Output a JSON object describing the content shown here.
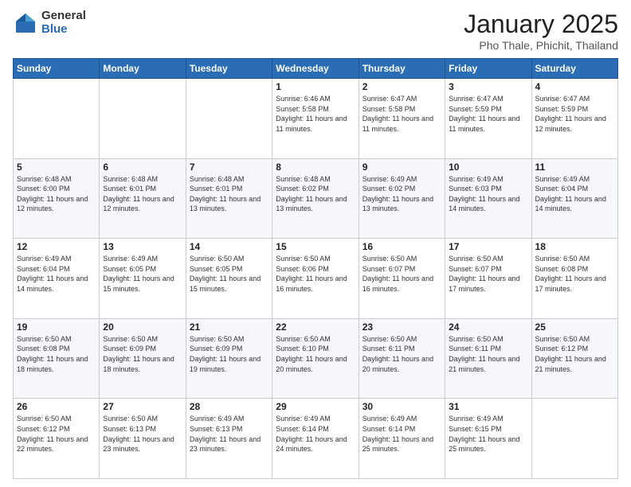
{
  "logo": {
    "general": "General",
    "blue": "Blue"
  },
  "title": {
    "month_year": "January 2025",
    "location": "Pho Thale, Phichit, Thailand"
  },
  "weekdays": [
    "Sunday",
    "Monday",
    "Tuesday",
    "Wednesday",
    "Thursday",
    "Friday",
    "Saturday"
  ],
  "weeks": [
    [
      {
        "day": "",
        "info": ""
      },
      {
        "day": "",
        "info": ""
      },
      {
        "day": "",
        "info": ""
      },
      {
        "day": "1",
        "info": "Sunrise: 6:46 AM\nSunset: 5:58 PM\nDaylight: 11 hours and 11 minutes."
      },
      {
        "day": "2",
        "info": "Sunrise: 6:47 AM\nSunset: 5:58 PM\nDaylight: 11 hours and 11 minutes."
      },
      {
        "day": "3",
        "info": "Sunrise: 6:47 AM\nSunset: 5:59 PM\nDaylight: 11 hours and 11 minutes."
      },
      {
        "day": "4",
        "info": "Sunrise: 6:47 AM\nSunset: 5:59 PM\nDaylight: 11 hours and 12 minutes."
      }
    ],
    [
      {
        "day": "5",
        "info": "Sunrise: 6:48 AM\nSunset: 6:00 PM\nDaylight: 11 hours and 12 minutes."
      },
      {
        "day": "6",
        "info": "Sunrise: 6:48 AM\nSunset: 6:01 PM\nDaylight: 11 hours and 12 minutes."
      },
      {
        "day": "7",
        "info": "Sunrise: 6:48 AM\nSunset: 6:01 PM\nDaylight: 11 hours and 13 minutes."
      },
      {
        "day": "8",
        "info": "Sunrise: 6:48 AM\nSunset: 6:02 PM\nDaylight: 11 hours and 13 minutes."
      },
      {
        "day": "9",
        "info": "Sunrise: 6:49 AM\nSunset: 6:02 PM\nDaylight: 11 hours and 13 minutes."
      },
      {
        "day": "10",
        "info": "Sunrise: 6:49 AM\nSunset: 6:03 PM\nDaylight: 11 hours and 14 minutes."
      },
      {
        "day": "11",
        "info": "Sunrise: 6:49 AM\nSunset: 6:04 PM\nDaylight: 11 hours and 14 minutes."
      }
    ],
    [
      {
        "day": "12",
        "info": "Sunrise: 6:49 AM\nSunset: 6:04 PM\nDaylight: 11 hours and 14 minutes."
      },
      {
        "day": "13",
        "info": "Sunrise: 6:49 AM\nSunset: 6:05 PM\nDaylight: 11 hours and 15 minutes."
      },
      {
        "day": "14",
        "info": "Sunrise: 6:50 AM\nSunset: 6:05 PM\nDaylight: 11 hours and 15 minutes."
      },
      {
        "day": "15",
        "info": "Sunrise: 6:50 AM\nSunset: 6:06 PM\nDaylight: 11 hours and 16 minutes."
      },
      {
        "day": "16",
        "info": "Sunrise: 6:50 AM\nSunset: 6:07 PM\nDaylight: 11 hours and 16 minutes."
      },
      {
        "day": "17",
        "info": "Sunrise: 6:50 AM\nSunset: 6:07 PM\nDaylight: 11 hours and 17 minutes."
      },
      {
        "day": "18",
        "info": "Sunrise: 6:50 AM\nSunset: 6:08 PM\nDaylight: 11 hours and 17 minutes."
      }
    ],
    [
      {
        "day": "19",
        "info": "Sunrise: 6:50 AM\nSunset: 6:08 PM\nDaylight: 11 hours and 18 minutes."
      },
      {
        "day": "20",
        "info": "Sunrise: 6:50 AM\nSunset: 6:09 PM\nDaylight: 11 hours and 18 minutes."
      },
      {
        "day": "21",
        "info": "Sunrise: 6:50 AM\nSunset: 6:09 PM\nDaylight: 11 hours and 19 minutes."
      },
      {
        "day": "22",
        "info": "Sunrise: 6:50 AM\nSunset: 6:10 PM\nDaylight: 11 hours and 20 minutes."
      },
      {
        "day": "23",
        "info": "Sunrise: 6:50 AM\nSunset: 6:11 PM\nDaylight: 11 hours and 20 minutes."
      },
      {
        "day": "24",
        "info": "Sunrise: 6:50 AM\nSunset: 6:11 PM\nDaylight: 11 hours and 21 minutes."
      },
      {
        "day": "25",
        "info": "Sunrise: 6:50 AM\nSunset: 6:12 PM\nDaylight: 11 hours and 21 minutes."
      }
    ],
    [
      {
        "day": "26",
        "info": "Sunrise: 6:50 AM\nSunset: 6:12 PM\nDaylight: 11 hours and 22 minutes."
      },
      {
        "day": "27",
        "info": "Sunrise: 6:50 AM\nSunset: 6:13 PM\nDaylight: 11 hours and 23 minutes."
      },
      {
        "day": "28",
        "info": "Sunrise: 6:49 AM\nSunset: 6:13 PM\nDaylight: 11 hours and 23 minutes."
      },
      {
        "day": "29",
        "info": "Sunrise: 6:49 AM\nSunset: 6:14 PM\nDaylight: 11 hours and 24 minutes."
      },
      {
        "day": "30",
        "info": "Sunrise: 6:49 AM\nSunset: 6:14 PM\nDaylight: 11 hours and 25 minutes."
      },
      {
        "day": "31",
        "info": "Sunrise: 6:49 AM\nSunset: 6:15 PM\nDaylight: 11 hours and 25 minutes."
      },
      {
        "day": "",
        "info": ""
      }
    ]
  ]
}
